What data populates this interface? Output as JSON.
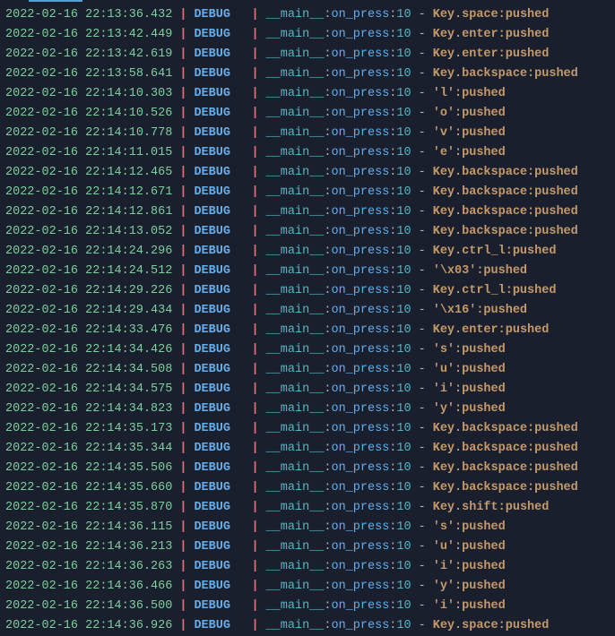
{
  "logs": [
    {
      "ts": "2022-02-16 22:13:36.432",
      "level": "DEBUG",
      "module": "__main__",
      "func": "on_press",
      "line": "10",
      "key": "Key.space ",
      "rest": ":pushed"
    },
    {
      "ts": "2022-02-16 22:13:42.449",
      "level": "DEBUG",
      "module": "__main__",
      "func": "on_press",
      "line": "10",
      "key": "Key.enter ",
      "rest": ":pushed"
    },
    {
      "ts": "2022-02-16 22:13:42.619",
      "level": "DEBUG",
      "module": "__main__",
      "func": "on_press",
      "line": "10",
      "key": "Key.enter ",
      "rest": ":pushed"
    },
    {
      "ts": "2022-02-16 22:13:58.641",
      "level": "DEBUG",
      "module": "__main__",
      "func": "on_press",
      "line": "10",
      "key": "Key.backspace ",
      "rest": ":pushed"
    },
    {
      "ts": "2022-02-16 22:14:10.303",
      "level": "DEBUG",
      "module": "__main__",
      "func": "on_press",
      "line": "10",
      "key": "'l' ",
      "rest": ":pushed"
    },
    {
      "ts": "2022-02-16 22:14:10.526",
      "level": "DEBUG",
      "module": "__main__",
      "func": "on_press",
      "line": "10",
      "key": "'o' ",
      "rest": ":pushed"
    },
    {
      "ts": "2022-02-16 22:14:10.778",
      "level": "DEBUG",
      "module": "__main__",
      "func": "on_press",
      "line": "10",
      "key": "'v' ",
      "rest": ":pushed"
    },
    {
      "ts": "2022-02-16 22:14:11.015",
      "level": "DEBUG",
      "module": "__main__",
      "func": "on_press",
      "line": "10",
      "key": "'e' ",
      "rest": ":pushed"
    },
    {
      "ts": "2022-02-16 22:14:12.465",
      "level": "DEBUG",
      "module": "__main__",
      "func": "on_press",
      "line": "10",
      "key": "Key.backspace ",
      "rest": ":pushed"
    },
    {
      "ts": "2022-02-16 22:14:12.671",
      "level": "DEBUG",
      "module": "__main__",
      "func": "on_press",
      "line": "10",
      "key": "Key.backspace ",
      "rest": ":pushed"
    },
    {
      "ts": "2022-02-16 22:14:12.861",
      "level": "DEBUG",
      "module": "__main__",
      "func": "on_press",
      "line": "10",
      "key": "Key.backspace ",
      "rest": ":pushed"
    },
    {
      "ts": "2022-02-16 22:14:13.052",
      "level": "DEBUG",
      "module": "__main__",
      "func": "on_press",
      "line": "10",
      "key": "Key.backspace ",
      "rest": ":pushed"
    },
    {
      "ts": "2022-02-16 22:14:24.296",
      "level": "DEBUG",
      "module": "__main__",
      "func": "on_press",
      "line": "10",
      "key": "Key.ctrl_l ",
      "rest": ":pushed"
    },
    {
      "ts": "2022-02-16 22:14:24.512",
      "level": "DEBUG",
      "module": "__main__",
      "func": "on_press",
      "line": "10",
      "key": "'\\x03' ",
      "rest": ":pushed"
    },
    {
      "ts": "2022-02-16 22:14:29.226",
      "level": "DEBUG",
      "module": "__main__",
      "func": "on_press",
      "line": "10",
      "key": "Key.ctrl_l ",
      "rest": ":pushed"
    },
    {
      "ts": "2022-02-16 22:14:29.434",
      "level": "DEBUG",
      "module": "__main__",
      "func": "on_press",
      "line": "10",
      "key": "'\\x16' ",
      "rest": ":pushed"
    },
    {
      "ts": "2022-02-16 22:14:33.476",
      "level": "DEBUG",
      "module": "__main__",
      "func": "on_press",
      "line": "10",
      "key": "Key.enter ",
      "rest": ":pushed"
    },
    {
      "ts": "2022-02-16 22:14:34.426",
      "level": "DEBUG",
      "module": "__main__",
      "func": "on_press",
      "line": "10",
      "key": "'s' ",
      "rest": ":pushed"
    },
    {
      "ts": "2022-02-16 22:14:34.508",
      "level": "DEBUG",
      "module": "__main__",
      "func": "on_press",
      "line": "10",
      "key": "'u' ",
      "rest": ":pushed"
    },
    {
      "ts": "2022-02-16 22:14:34.575",
      "level": "DEBUG",
      "module": "__main__",
      "func": "on_press",
      "line": "10",
      "key": "'i' ",
      "rest": ":pushed"
    },
    {
      "ts": "2022-02-16 22:14:34.823",
      "level": "DEBUG",
      "module": "__main__",
      "func": "on_press",
      "line": "10",
      "key": "'y' ",
      "rest": ":pushed"
    },
    {
      "ts": "2022-02-16 22:14:35.173",
      "level": "DEBUG",
      "module": "__main__",
      "func": "on_press",
      "line": "10",
      "key": "Key.backspace ",
      "rest": ":pushed"
    },
    {
      "ts": "2022-02-16 22:14:35.344",
      "level": "DEBUG",
      "module": "__main__",
      "func": "on_press",
      "line": "10",
      "key": "Key.backspace ",
      "rest": ":pushed"
    },
    {
      "ts": "2022-02-16 22:14:35.506",
      "level": "DEBUG",
      "module": "__main__",
      "func": "on_press",
      "line": "10",
      "key": "Key.backspace ",
      "rest": ":pushed"
    },
    {
      "ts": "2022-02-16 22:14:35.660",
      "level": "DEBUG",
      "module": "__main__",
      "func": "on_press",
      "line": "10",
      "key": "Key.backspace ",
      "rest": ":pushed"
    },
    {
      "ts": "2022-02-16 22:14:35.870",
      "level": "DEBUG",
      "module": "__main__",
      "func": "on_press",
      "line": "10",
      "key": "Key.shift ",
      "rest": ":pushed"
    },
    {
      "ts": "2022-02-16 22:14:36.115",
      "level": "DEBUG",
      "module": "__main__",
      "func": "on_press",
      "line": "10",
      "key": "'s' ",
      "rest": ":pushed"
    },
    {
      "ts": "2022-02-16 22:14:36.213",
      "level": "DEBUG",
      "module": "__main__",
      "func": "on_press",
      "line": "10",
      "key": "'u' ",
      "rest": ":pushed"
    },
    {
      "ts": "2022-02-16 22:14:36.263",
      "level": "DEBUG",
      "module": "__main__",
      "func": "on_press",
      "line": "10",
      "key": "'i' ",
      "rest": ":pushed"
    },
    {
      "ts": "2022-02-16 22:14:36.466",
      "level": "DEBUG",
      "module": "__main__",
      "func": "on_press",
      "line": "10",
      "key": "'y' ",
      "rest": ":pushed"
    },
    {
      "ts": "2022-02-16 22:14:36.500",
      "level": "DEBUG",
      "module": "__main__",
      "func": "on_press",
      "line": "10",
      "key": "'i' ",
      "rest": ":pushed"
    },
    {
      "ts": "2022-02-16 22:14:36.926",
      "level": "DEBUG",
      "module": "__main__",
      "func": "on_press",
      "line": "10",
      "key": "Key.space ",
      "rest": ":pushed"
    }
  ]
}
